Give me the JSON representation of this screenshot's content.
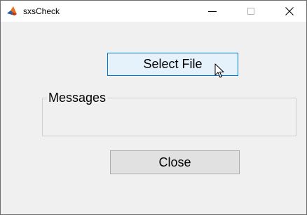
{
  "window": {
    "title": "sxsCheck",
    "controls": {
      "minimize_icon": "minimize-icon",
      "maximize_icon": "maximize-icon",
      "close_glyph": "✕"
    }
  },
  "main": {
    "select_file_label": "Select File",
    "messages_label": "Messages",
    "close_label": "Close"
  },
  "colors": {
    "window_bg": "#f0f0f0",
    "button_hover_bg": "#e5f1fb",
    "button_hover_border": "#0078d7",
    "button_bg": "#e1e1e1"
  }
}
